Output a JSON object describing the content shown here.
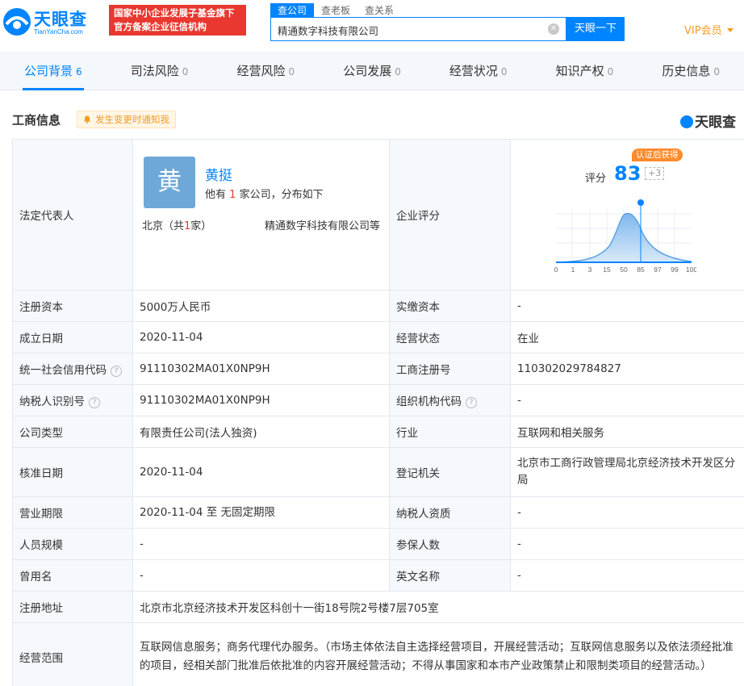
{
  "brand": {
    "name": "天眼查",
    "domain": "TianYanCha.com",
    "badge_line1": "国家中小企业发展子基金旗下",
    "badge_line2": "官方备案企业征信机构"
  },
  "search": {
    "tabs": [
      "查公司",
      "查老板",
      "查关系"
    ],
    "active_tab": 0,
    "value": "精通数字科技有限公司",
    "button": "天眼一下"
  },
  "vip": {
    "label": "VIP会员"
  },
  "nav": [
    {
      "label": "公司背景",
      "count": "6",
      "active": true
    },
    {
      "label": "司法风险",
      "count": "0"
    },
    {
      "label": "经营风险",
      "count": "0"
    },
    {
      "label": "公司发展",
      "count": "0"
    },
    {
      "label": "经营状况",
      "count": "0"
    },
    {
      "label": "知识产权",
      "count": "0"
    },
    {
      "label": "历史信息",
      "count": "0"
    }
  ],
  "section": {
    "title": "工商信息",
    "notify": "发生变更时通知我",
    "mark": "天眼查"
  },
  "rep": {
    "label": "法定代表人",
    "avatar_char": "黄",
    "name": "黄挺",
    "desc_pre": "他有",
    "company_count": "1",
    "desc_post": "家公司，分布如下",
    "city_pre": "北京（共",
    "city_count": "1",
    "city_post": "家）",
    "company": "精通数字科技有限公司等"
  },
  "score": {
    "label": "企业评分",
    "badge": "认证后获得",
    "title": "评分",
    "value": "83",
    "plus": "+3",
    "ticks": [
      "0",
      "1",
      "3",
      "15",
      "50",
      "85",
      "97",
      "99",
      "100"
    ]
  },
  "rows": [
    [
      "注册资本",
      "5000万人民币",
      "实缴资本",
      "-"
    ],
    [
      "成立日期",
      "2020-11-04",
      "经营状态",
      "在业"
    ],
    [
      "统一社会信用代码",
      "91110302MA01X0NP9H",
      "工商注册号",
      "110302029784827"
    ],
    [
      "纳税人识别号",
      "91110302MA01X0NP9H",
      "组织机构代码",
      "-"
    ],
    [
      "公司类型",
      "有限责任公司(法人独资)",
      "行业",
      "互联网和相关服务"
    ],
    [
      "核准日期",
      "2020-11-04",
      "登记机关",
      "北京市工商行政管理局北京经济技术开发区分局"
    ],
    [
      "营业期限",
      "2020-11-04  至  无固定期限",
      "纳税人资质",
      "-"
    ],
    [
      "人员规模",
      "-",
      "参保人数",
      "-"
    ],
    [
      "曾用名",
      "-",
      "英文名称",
      "-"
    ]
  ],
  "address": {
    "label": "注册地址",
    "value": "北京市北京经济技术开发区科创十一街18号院2号楼7层705室"
  },
  "scope": {
    "label": "经营范围",
    "value": "互联网信息服务；商务代理代办服务。（市场主体依法自主选择经营项目，开展经营活动；互联网信息服务以及依法须经批准的项目，经相关部门批准后依批准的内容开展经营活动；不得从事国家和本市产业政策禁止和限制类项目的经营活动。）"
  }
}
